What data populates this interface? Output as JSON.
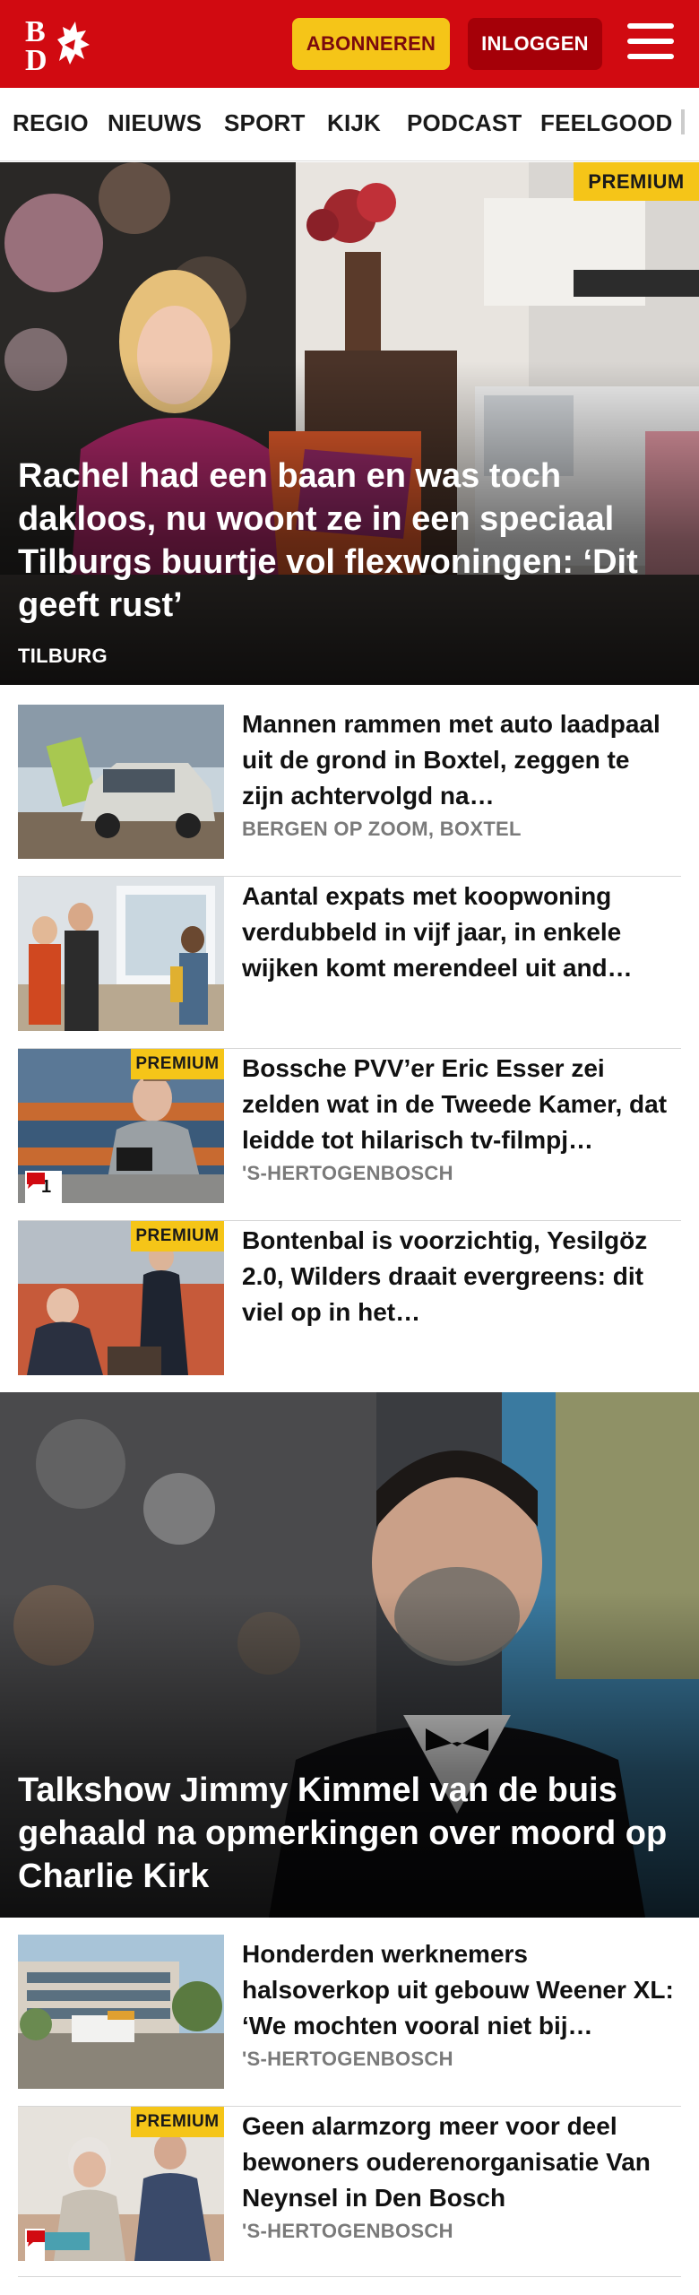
{
  "header": {
    "logo_letters": "BD",
    "subscribe_label": "ABONNEREN",
    "login_label": "INLOGGEN"
  },
  "nav": {
    "items": [
      "REGIO",
      "NIEUWS",
      "SPORT",
      "KIJK",
      "PODCAST",
      "FEELGOOD"
    ]
  },
  "hero1": {
    "badge": "PREMIUM",
    "title": "Rachel had een baan en was toch dakloos, nu woont ze in een speciaal Tilburgs buurtje vol flexwoningen: ‘Dit geeft rust’",
    "location": "TILBURG"
  },
  "list1": [
    {
      "title": "Mannen rammen met auto laadpaal uit de grond in Boxtel, zeggen te zijn achtervolgd na…",
      "location": "BERGEN OP ZOOM, BOXTEL"
    },
    {
      "title": "Aantal expats met koopwoning verdubbeld in vijf jaar, in enkele wijken komt merendeel uit and…",
      "location": ""
    },
    {
      "title": "Bossche PVV’er Eric Esser zei zelden wat in de Tweede Kamer, dat leidde tot hilarisch tv-filmpj…",
      "location": "'S-HERTOGENBOSCH",
      "badge": "PREMIUM",
      "comments": "1"
    },
    {
      "title": "Bontenbal is voorzichtig, Yesilgöz 2.0, Wilders draait evergreens: dit viel op in het…",
      "location": "",
      "badge": "PREMIUM"
    }
  ],
  "hero2": {
    "title": "Talkshow Jimmy Kimmel van de buis gehaald na opmerkingen over moord op Charlie Kirk"
  },
  "list2": [
    {
      "title": "Honderden werknemers halsoverkop uit gebouw Weener XL: ‘We mochten vooral niet bij…",
      "location": "'S-HERTOGENBOSCH"
    },
    {
      "title": "Geen alarmzorg meer voor deel bewoners ouderenorganisatie Van Neynsel in Den Bosch",
      "location": "'S-HERTOGENBOSCH",
      "badge": "PREMIUM"
    }
  ],
  "colors": {
    "brand_red": "#d10a11",
    "premium_yellow": "#f5c518",
    "login_dark_red": "#a50008"
  }
}
